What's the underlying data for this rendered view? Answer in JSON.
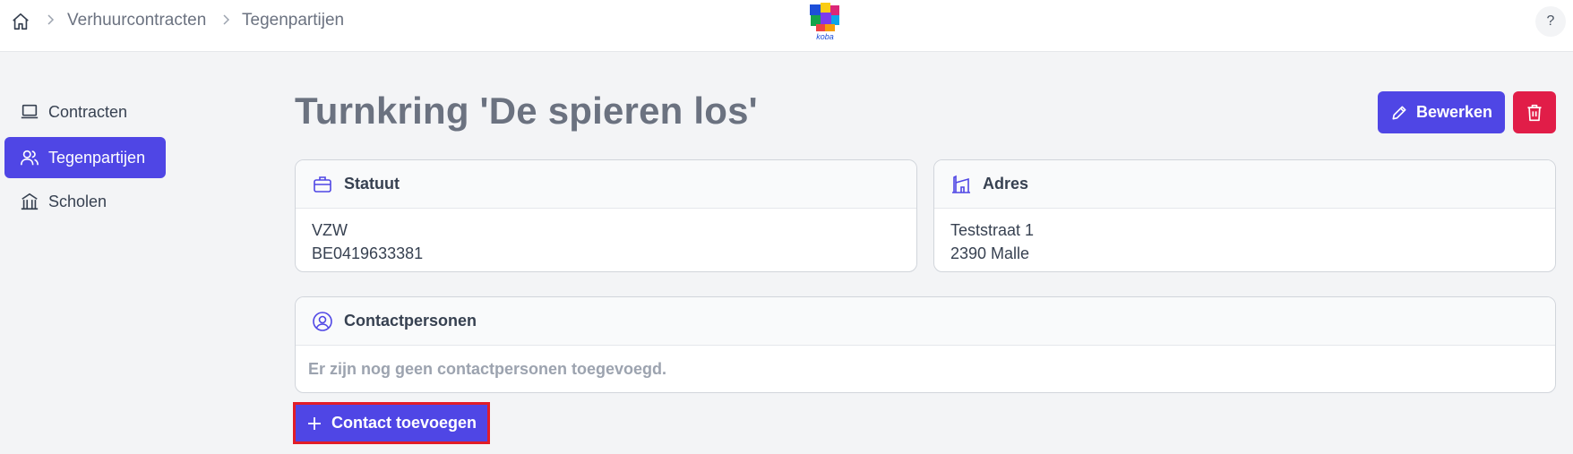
{
  "breadcrumb": {
    "items": [
      "Verhuurcontracten",
      "Tegenpartijen"
    ]
  },
  "logo": {
    "text": "koba"
  },
  "help": {
    "label": "?"
  },
  "sidebar": {
    "items": [
      {
        "label": "Contracten",
        "icon": "laptop-icon",
        "active": false
      },
      {
        "label": "Tegenpartijen",
        "icon": "users-icon",
        "active": true
      },
      {
        "label": "Scholen",
        "icon": "school-building-icon",
        "active": false
      }
    ]
  },
  "page": {
    "title": "Turnkring 'De spieren los'",
    "edit_label": "Bewerken",
    "delete_icon": "trash-icon"
  },
  "statuut": {
    "title": "Statuut",
    "lines": [
      "VZW",
      "BE0419633381"
    ]
  },
  "adres": {
    "title": "Adres",
    "lines": [
      "Teststraat 1",
      "2390 Malle"
    ]
  },
  "contacts": {
    "title": "Contactpersonen",
    "empty_text": "Er zijn nog geen contactpersonen toegevoegd.",
    "add_label": "Contact toevoegen"
  },
  "colors": {
    "accent": "#4f46e5",
    "danger": "#e11d48",
    "highlight": "#e11d28"
  }
}
